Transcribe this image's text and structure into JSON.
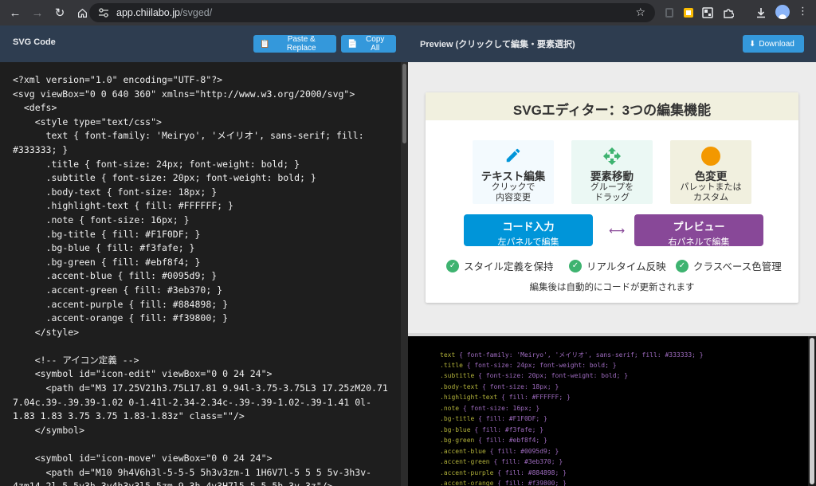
{
  "browser": {
    "url_host": "app.chiilabo.jp",
    "url_path": "/svged/"
  },
  "header": {
    "code_title": "SVG Code",
    "paste_label": "Paste & Replace",
    "copy_label": "Copy All",
    "preview_title": "Preview (クリックして編集・要素選択)",
    "download_label": "Download"
  },
  "code": {
    "text": "<?xml version=\"1.0\" encoding=\"UTF-8\"?>\n<svg viewBox=\"0 0 640 360\" xmlns=\"http://www.w3.org/2000/svg\">\n  <defs>\n    <style type=\"text/css\">\n      text { font-family: 'Meiryo', 'メイリオ', sans-serif; fill: #333333; }\n      .title { font-size: 24px; font-weight: bold; }\n      .subtitle { font-size: 20px; font-weight: bold; }\n      .body-text { font-size: 18px; }\n      .highlight-text { fill: #FFFFFF; }\n      .note { font-size: 16px; }\n      .bg-title { fill: #F1F0DF; }\n      .bg-blue { fill: #f3fafe; }\n      .bg-green { fill: #ebf8f4; }\n      .accent-blue { fill: #0095d9; }\n      .accent-green { fill: #3eb370; }\n      .accent-purple { fill: #884898; }\n      .accent-orange { fill: #f39800; }\n    </style>\n\n    <!-- アイコン定義 -->\n    <symbol id=\"icon-edit\" viewBox=\"0 0 24 24\">\n      <path d=\"M3 17.25V21h3.75L17.81 9.94l-3.75-3.75L3 17.25zM20.71 7.04c.39-.39.39-1.02 0-1.41l-2.34-2.34c-.39-.39-1.02-.39-1.41 0l-1.83 1.83 3.75 3.75 1.83-1.83z\" class=\"\"/>\n    </symbol>\n\n    <symbol id=\"icon-move\" viewBox=\"0 0 24 24\">\n      <path d=\"M10 9h4V6h3l-5-5-5 5h3v3zm-1 1H6V7l-5 5 5 5v-3h3v-4zm14 2l-5-5v3h-3v4h3v3l5-5zm-9 3h-4v3H7l5 5 5-5h-3v-3z\"/>"
  },
  "preview": {
    "title": "SVGエディター：3つの編集機能",
    "features": [
      {
        "heading": "テキスト編集",
        "line1": "クリックで",
        "line2": "内容変更",
        "icon": "pencil-icon"
      },
      {
        "heading": "要素移動",
        "line1": "グループを",
        "line2": "ドラッグ",
        "icon": "move-icon"
      },
      {
        "heading": "色変更",
        "line1": "パレットまたは",
        "line2": "カスタム",
        "icon": "color-dot-icon"
      }
    ],
    "panels": [
      {
        "heading": "コード入力",
        "sub": "左パネルで編集"
      },
      {
        "heading": "プレビュー",
        "sub": "右パネルで編集"
      }
    ],
    "checks": [
      "スタイル定義を保持",
      "リアルタイム反映",
      "クラスベース色管理"
    ],
    "note": "編集後は自動的にコードが更新されます",
    "colors": {
      "title_bg": "#F1F0DF",
      "bg_blue": "#f3fafe",
      "bg_green": "#ebf8f4",
      "accent_blue": "#0095d9",
      "accent_green": "#3eb370",
      "accent_purple": "#884898",
      "accent_orange": "#f39800"
    }
  },
  "bottom_code": [
    {
      "sel": "text",
      "body": "font-family: 'Meiryo', 'メイリオ', sans-serif; fill: #333333;"
    },
    {
      "sel": ".title",
      "body": "font-size: 24px; font-weight: bold;"
    },
    {
      "sel": ".subtitle",
      "body": "font-size: 20px; font-weight: bold;"
    },
    {
      "sel": ".body-text",
      "body": "font-size: 18px;"
    },
    {
      "sel": ".highlight-text",
      "body": "fill: #FFFFFF;"
    },
    {
      "sel": ".note",
      "body": "font-size: 16px;"
    },
    {
      "sel": ".bg-title",
      "body": "fill: #F1F0DF;"
    },
    {
      "sel": ".bg-blue",
      "body": "fill: #f3fafe;"
    },
    {
      "sel": ".bg-green",
      "body": "fill: #ebf8f4;"
    },
    {
      "sel": ".accent-blue",
      "body": "fill: #0095d9;"
    },
    {
      "sel": ".accent-green",
      "body": "fill: #3eb370;"
    },
    {
      "sel": ".accent-purple",
      "body": "fill: #884898;"
    },
    {
      "sel": ".accent-orange",
      "body": "fill: #f39800;"
    }
  ]
}
